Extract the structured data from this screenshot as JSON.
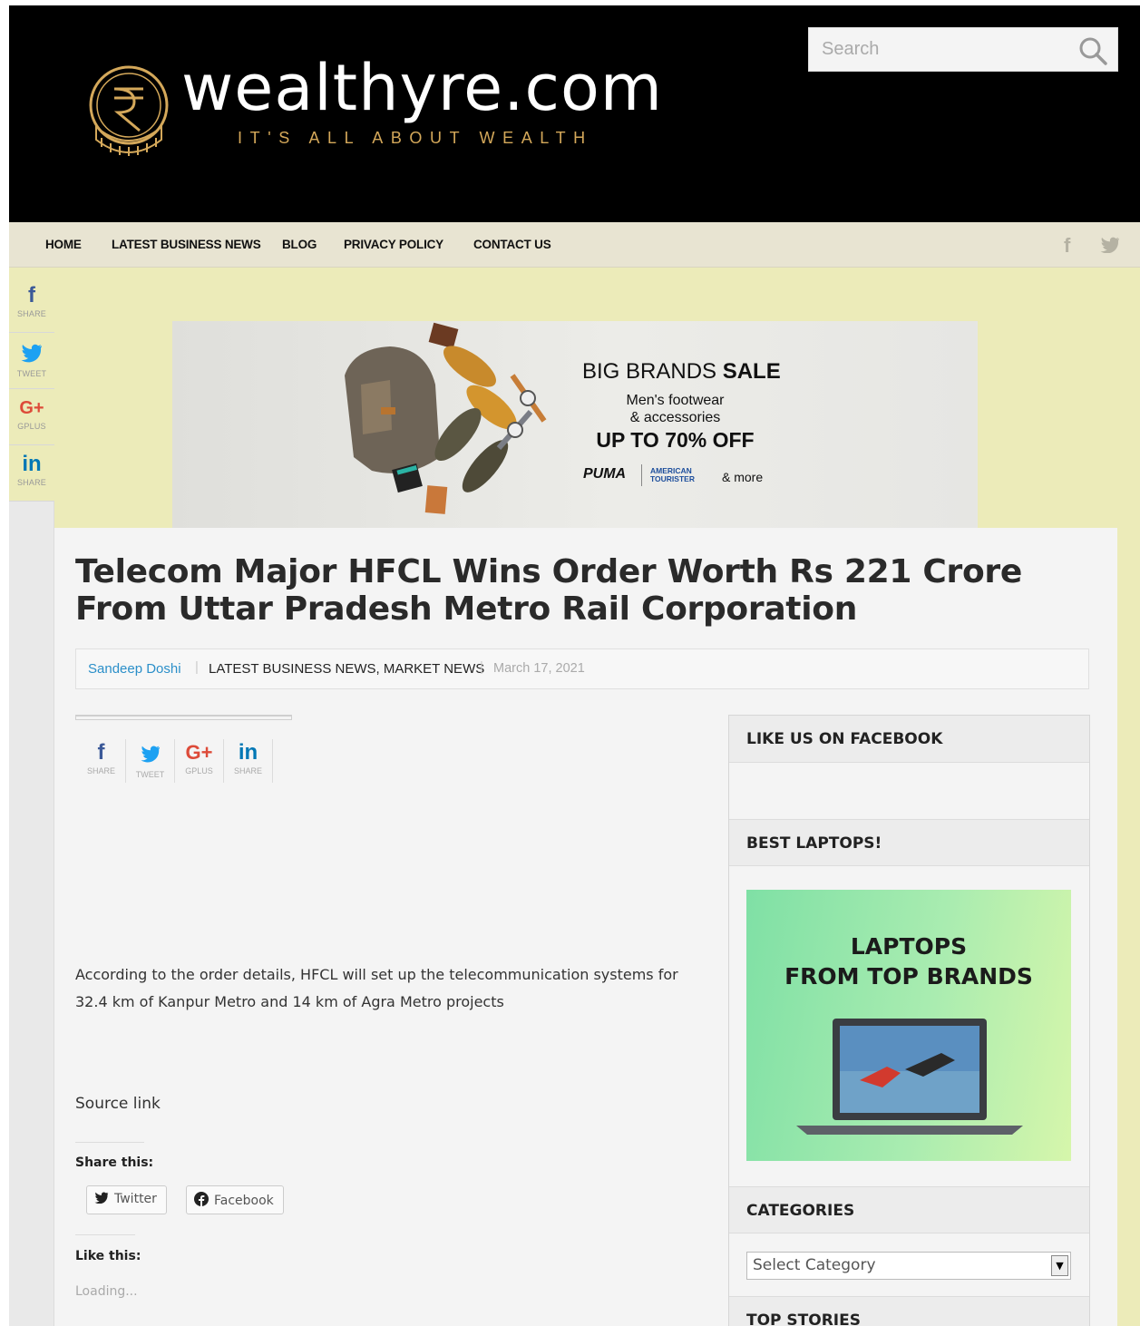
{
  "site": {
    "name": "wealthyre.com",
    "tagline": "IT'S ALL ABOUT WEALTH",
    "brand_color": "#d4a85a"
  },
  "search": {
    "placeholder": "Search"
  },
  "nav": {
    "items": [
      "HOME",
      "LATEST BUSINESS NEWS",
      "BLOG",
      "PRIVACY POLICY",
      "CONTACT US"
    ],
    "social": [
      "facebook-icon",
      "twitter-icon"
    ]
  },
  "float_share": [
    {
      "icon": "f",
      "label": "SHARE",
      "color": "#3b5998",
      "icon_name": "facebook-icon"
    },
    {
      "icon": "t",
      "label": "TWEET",
      "color": "#1da1f2",
      "icon_name": "twitter-icon"
    },
    {
      "icon": "G+",
      "label": "GPLUS",
      "color": "#dd4b39",
      "icon_name": "google-plus-icon"
    },
    {
      "icon": "in",
      "label": "SHARE",
      "color": "#0077b5",
      "icon_name": "linkedin-icon"
    }
  ],
  "ad": {
    "line1_regular": "BIG BRANDS ",
    "line1_bold": "SALE",
    "line2": "Men's footwear",
    "line3": "& accessories",
    "line4": "UP TO 70% OFF",
    "brand1": "PUMA",
    "brand2": "AMERICAN TOURISTER",
    "more": "& more"
  },
  "article": {
    "title": "Telecom Major HFCL Wins Order Worth Rs 221 Crore From Uttar Pradesh Metro Rail Corporation",
    "author": "Sandeep Doshi",
    "categories": "LATEST BUSINESS NEWS, MARKET NEWS",
    "date": "March 17, 2021",
    "body": "According to the order details, HFCL will set up the telecommunication systems for 32.4 km of Kanpur Metro and 14 km of Agra Metro projects",
    "source": "Source link",
    "share_this": "Share this:",
    "share_buttons": [
      "Twitter",
      "Facebook"
    ],
    "like_this": "Like this:",
    "loading": "Loading..."
  },
  "sidebar": {
    "widget1": "LIKE US ON FACEBOOK",
    "widget2": "BEST LAPTOPS!",
    "laptop_ad_line1": "LAPTOPS",
    "laptop_ad_line2": "FROM TOP BRANDS",
    "widget3": "CATEGORIES",
    "select_value": "Select Category",
    "widget4": "TOP STORIES"
  }
}
